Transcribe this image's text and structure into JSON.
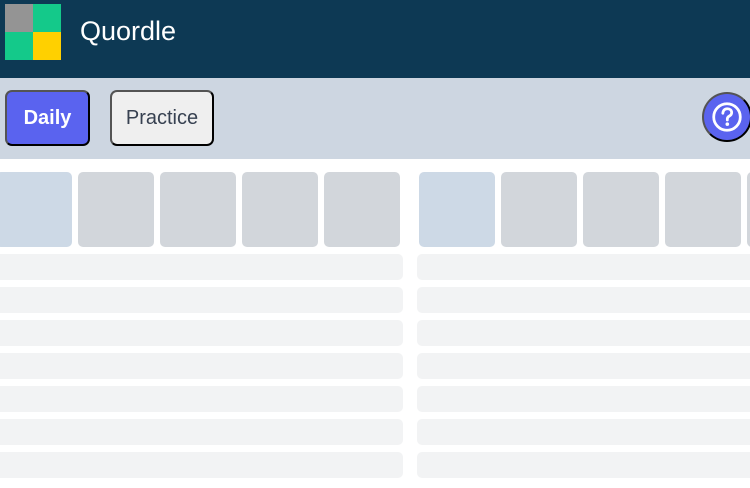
{
  "header": {
    "title": "Quordle",
    "logo_colors": [
      "#949494",
      "#14c98a",
      "#14c98a",
      "#ffd000"
    ]
  },
  "tabs": [
    {
      "label": "Daily",
      "selected": true
    },
    {
      "label": "Practice",
      "selected": false
    }
  ],
  "help": {
    "icon": "question-circle-icon"
  },
  "colors": {
    "header_bg": "#0d3954",
    "tabbar_bg": "#cdd6e1",
    "accent": "#5a63ef",
    "tile_empty": "#d2d6db",
    "tile_active": "#cdd9e6",
    "row_placeholder": "#f2f3f4"
  },
  "boards": [
    {
      "visible_tiles": 5,
      "active_tile_index": 0,
      "placeholder_rows": 7
    },
    {
      "visible_tiles": 4,
      "active_tile_index": 0,
      "placeholder_rows": 7
    }
  ]
}
